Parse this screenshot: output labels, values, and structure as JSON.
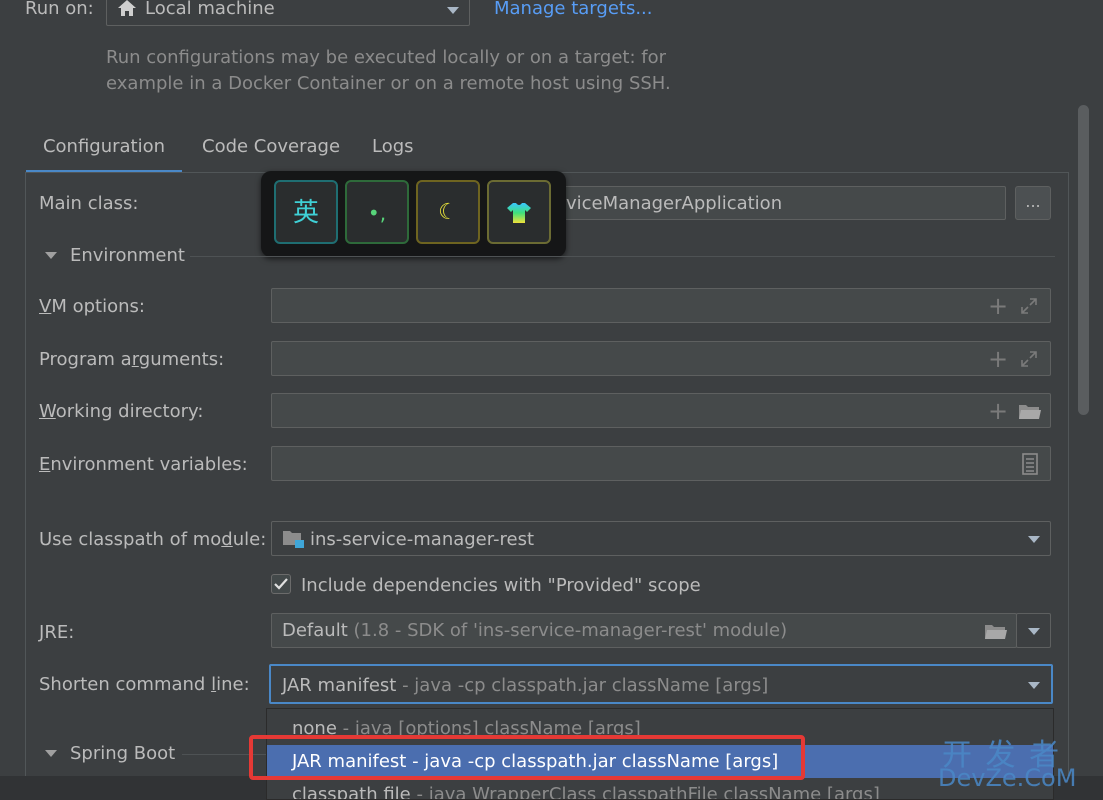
{
  "run_on": {
    "label": "Run on:",
    "target_value": "Local machine",
    "manage_link": "Manage targets...",
    "description_line1": "Run configurations may be executed locally or on a target: for",
    "description_line2": "example in a Docker Container or on a remote host using SSH."
  },
  "tabs": [
    {
      "label": "Configuration",
      "active": true
    },
    {
      "label": "Code Coverage",
      "active": false
    },
    {
      "label": "Logs",
      "active": false
    }
  ],
  "ime_toolbar": {
    "keys": [
      "英",
      "•,",
      "☾",
      "shirt"
    ]
  },
  "main_class": {
    "label": "Main class:",
    "value": "viceManagerApplication",
    "browse_label": "..."
  },
  "environment": {
    "title_pre": "Environment",
    "vm_options": {
      "label_u": "V",
      "label_rest": "M options:",
      "value": ""
    },
    "program_arguments": {
      "label_pre": "Program a",
      "label_u": "r",
      "label_rest": "guments:",
      "value": ""
    },
    "working_directory": {
      "label_u": "W",
      "label_rest": "orking directory:",
      "value": ""
    },
    "environment_variables": {
      "label_u": "E",
      "label_rest": "nvironment variables:",
      "value": ""
    }
  },
  "classpath": {
    "label_pre": "Use classpath of mo",
    "label_u": "d",
    "label_rest": "ule:",
    "module": "ins-service-manager-rest"
  },
  "include_provided": {
    "checked": true,
    "label": "Include dependencies with \"Provided\" scope"
  },
  "jre": {
    "label_u": "J",
    "label_rest": "RE:",
    "value_main": "Default",
    "value_hint": "(1.8 - SDK of 'ins-service-manager-rest' module)"
  },
  "shorten": {
    "label_pre": "Shorten command ",
    "label_u": "l",
    "label_rest": "ine:",
    "value_main": "JAR manifest",
    "value_hint": "- java -cp classpath.jar className [args]",
    "options": [
      {
        "main": "none",
        "hint": "- java [options] className [args]",
        "selected": false
      },
      {
        "main": "JAR manifest",
        "hint": "- java -cp classpath.jar className [args]",
        "selected": true
      },
      {
        "main": "classpath file",
        "hint": "- java WrapperClass classpathFile className [args]",
        "selected": false
      }
    ]
  },
  "spring_boot": {
    "label": "Spring Boot"
  },
  "watermark": {
    "line1": "开 发 者",
    "line2": "DevZe.CoM"
  },
  "colors": {
    "accent": "#4a88c7",
    "selection": "#4b6eaf",
    "highlight_box": "#e53935",
    "link": "#589df6"
  }
}
